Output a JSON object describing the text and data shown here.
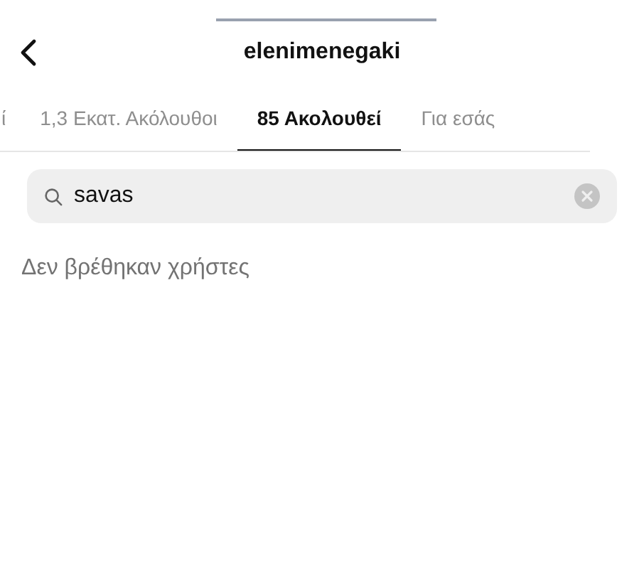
{
  "header": {
    "title": "elenimenegaki"
  },
  "tabs": [
    {
      "label": "ί",
      "selected": false
    },
    {
      "label": "1,3 Εκατ. Ακόλουθοι",
      "selected": false
    },
    {
      "label": "85 Ακολουθεί",
      "selected": true
    },
    {
      "label": "Για εσάς",
      "selected": false
    }
  ],
  "search": {
    "value": "savas"
  },
  "message": "Δεν βρέθηκαν χρήστες"
}
